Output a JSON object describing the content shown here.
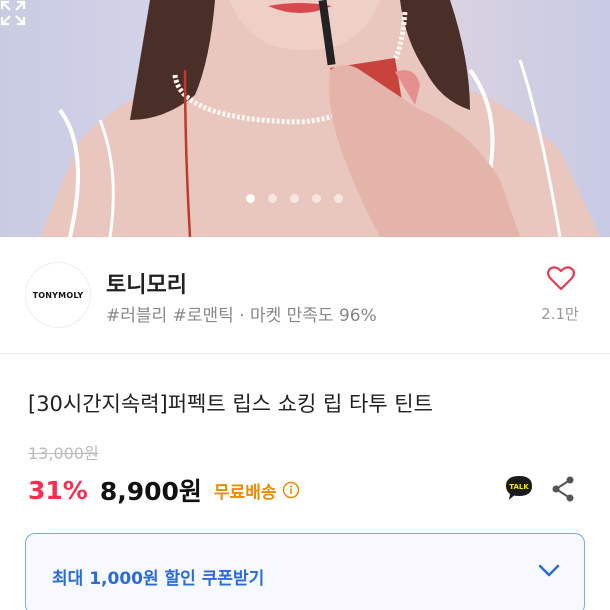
{
  "hero": {
    "slide_count": 5,
    "active_slide": 1,
    "expand_icon": "expand-icon"
  },
  "seller": {
    "logo_text": "TONYMOLY",
    "name": "토니모리",
    "tags": "#러블리 #로맨틱 · 마켓 만족도 96%",
    "likes": "2.1만",
    "heart_icon": "heart-outline-icon"
  },
  "product": {
    "title": "[30시간지속력]퍼펙트 립스 쇼킹 립 타투 틴트",
    "original_price": "13,000원",
    "discount": "31%",
    "price": "8,900원",
    "shipping": "무료배송"
  },
  "actions": {
    "talk_label": "TALK",
    "share_icon": "share-icon"
  },
  "coupon": {
    "label": "최대 1,000원 할인 쿠폰받기"
  },
  "colors": {
    "discount": "#fa2d50",
    "shipping": "#ee8b00",
    "coupon_text": "#2d6bd6",
    "coupon_border": "#7aa8f5"
  }
}
